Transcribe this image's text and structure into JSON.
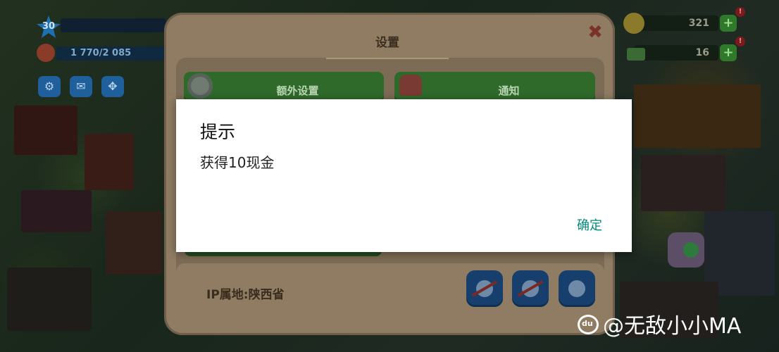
{
  "hud": {
    "level": "30",
    "xp_progress": "1 770/2 085",
    "currencies": [
      {
        "amount": "321",
        "icon": "coin-icon",
        "alert": "!"
      },
      {
        "amount": "16",
        "icon": "cash-icon",
        "alert": "!"
      }
    ],
    "left_buttons": [
      {
        "icon": "gear-icon",
        "glyph": "⚙"
      },
      {
        "icon": "mail-icon",
        "glyph": "✉"
      },
      {
        "icon": "move-icon",
        "glyph": "✥"
      }
    ],
    "plus_glyph": "+"
  },
  "settings_panel": {
    "tab_title": "设置",
    "close_glyph": "✖",
    "buttons": [
      {
        "label": "额外设置",
        "icon": "gear-icon"
      },
      {
        "label": "通知",
        "icon": "bell-icon"
      }
    ],
    "ip_location": "IP属地:陕西省",
    "bottom_buttons": [
      {
        "icon": "muted-music-icon"
      },
      {
        "icon": "muted-sound-icon"
      },
      {
        "icon": "globe-icon"
      }
    ]
  },
  "dialog": {
    "title": "提示",
    "message": "获得10现金",
    "confirm_label": "确定"
  },
  "watermark": {
    "logo_text": "du",
    "text": "@无敌小小MA"
  },
  "colors": {
    "dialog_bg": "#ffffff",
    "confirm_text": "#00897b",
    "green_button": "#2f6a2b",
    "panel_bg": "#8f7c63"
  }
}
